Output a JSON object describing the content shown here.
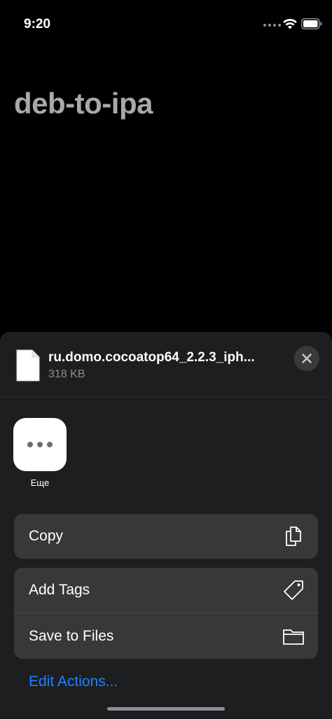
{
  "status_bar": {
    "time": "9:20"
  },
  "app": {
    "title": "deb-to-ipa"
  },
  "share_sheet": {
    "file_name": "ru.domo.cocoatop64_2.2.3_iph...",
    "file_size": "318 KB",
    "apps": [
      {
        "label": "Еще",
        "icon": "more-icon"
      }
    ],
    "actions_group1": [
      {
        "label": "Copy",
        "icon": "copy-icon"
      }
    ],
    "actions_group2": [
      {
        "label": "Add Tags",
        "icon": "tag-icon"
      },
      {
        "label": "Save to Files",
        "icon": "folder-icon"
      }
    ],
    "edit_actions": "Edit Actions..."
  },
  "colors": {
    "link": "#1b84ff",
    "sheet": "#1d1e20",
    "row": "#38383b"
  }
}
